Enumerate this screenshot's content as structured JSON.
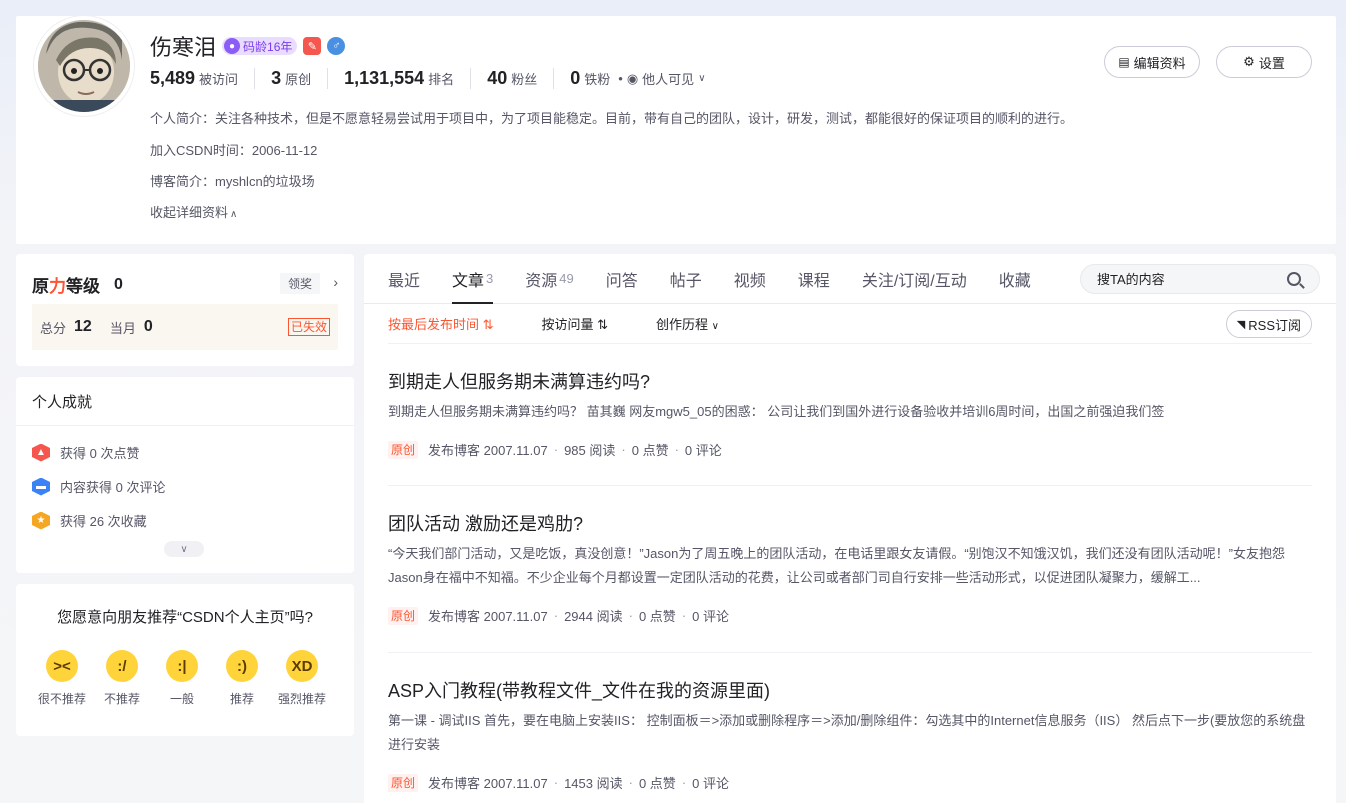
{
  "profile": {
    "nickname": "伤寒泪",
    "code_age_badge": "码龄16年",
    "stats": [
      {
        "value": "5,489",
        "label": "被访问"
      },
      {
        "value": "3",
        "label": "原创"
      },
      {
        "value": "1,131,554",
        "label": "排名"
      },
      {
        "value": "40",
        "label": "粉丝"
      },
      {
        "value": "0",
        "label": "铁粉"
      }
    ],
    "visibility": "他人可见",
    "intro": "个人简介：关注各种技术，但是不愿意轻易尝试用于项目中，为了项目能稳定。目前，带有自己的团队，设计，研发，测试，都能很好的保证项目的顺利的进行。",
    "join_date": "加入CSDN时间：2006-11-12",
    "blog_intro": "博客简介：myshlcn的垃圾场",
    "collapse_label": "收起详细资料",
    "edit_label": "编辑资料",
    "settings_label": "设置"
  },
  "level": {
    "title_a": "原",
    "title_b": "力",
    "title_c": "等级",
    "value": "0",
    "reward_label": "领奖",
    "total_label": "总分",
    "total": "12",
    "month_label": "当月",
    "month": "0",
    "expired_label": "已失效"
  },
  "achievements": {
    "title": "个人成就",
    "items": [
      {
        "text": "获得 0 次点赞",
        "color": "#f5564e",
        "icon": "thumb-icon"
      },
      {
        "text": "内容获得 0 次评论",
        "color": "#3b82f6",
        "icon": "comment-icon"
      },
      {
        "text": "获得 26 次收藏",
        "color": "#f5a623",
        "icon": "star-icon"
      }
    ]
  },
  "recommend": {
    "question": "您愿意向朋友推荐“CSDN个人主页”吗?",
    "options": [
      "很不推荐",
      "不推荐",
      "一般",
      "推荐",
      "强烈推荐"
    ]
  },
  "tabs": [
    {
      "label": "最近",
      "count": ""
    },
    {
      "label": "文章",
      "count": "3"
    },
    {
      "label": "资源",
      "count": "49"
    },
    {
      "label": "问答",
      "count": ""
    },
    {
      "label": "帖子",
      "count": ""
    },
    {
      "label": "视频",
      "count": ""
    },
    {
      "label": "课程",
      "count": ""
    },
    {
      "label": "关注/订阅/互动",
      "count": ""
    },
    {
      "label": "收藏",
      "count": ""
    }
  ],
  "search": {
    "placeholder": "搜TA的内容"
  },
  "sort": {
    "by_time": "按最后发布时间 ⇅",
    "by_views": "按访问量 ⇅",
    "history": "创作历程",
    "rss": "RSS订阅"
  },
  "articles": [
    {
      "title": "到期走人但服务期未满算违约吗?",
      "desc": "到期走人但服务期未满算违约吗？  苗其巍  网友mgw5_05的困惑：      公司让我们到国外进行设备验收并培训6周时间，出国之前强迫我们签",
      "tag": "原创",
      "date": "发布博客 2007.11.07",
      "views": "985 阅读",
      "likes": "0 点赞",
      "comments": "0 评论"
    },
    {
      "title": "团队活动 激励还是鸡肋?",
      "desc": "“今天我们部门活动，又是吃饭，真没创意！”Jason为了周五晚上的团队活动，在电话里跟女友请假。“别饱汉不知饿汉饥，我们还没有团队活动呢！”女友抱怨Jason身在福中不知福。不少企业每个月都设置一定团队活动的花费，让公司或者部门司自行安排一些活动形式，以促进团队凝聚力，缓解工...",
      "tag": "原创",
      "date": "发布博客 2007.11.07",
      "views": "2944 阅读",
      "likes": "0 点赞",
      "comments": "0 评论"
    },
    {
      "title": "ASP入门教程(带教程文件_文件在我的资源里面)",
      "desc": "第一课 - 调试IIS       首先，要在电脑上安装IIS：        控制面板＝>添加或删除程序＝>添加/删除组件：勾选其中的Internet信息服务（IIS）      然后点下一步(要放您的系统盘进行安装",
      "tag": "原创",
      "date": "发布博客 2007.11.07",
      "views": "1453 阅读",
      "likes": "0 点赞",
      "comments": "0 评论"
    }
  ]
}
